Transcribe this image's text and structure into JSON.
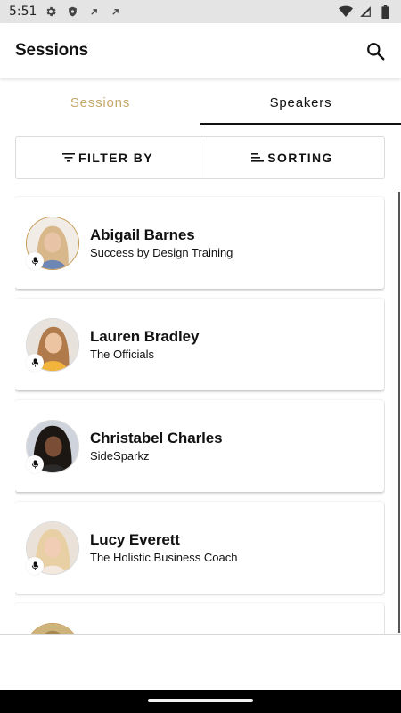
{
  "status_bar": {
    "time": "5:51",
    "left_icons": [
      "gear-icon",
      "shield-icon",
      "sync-icon",
      "sync-icon"
    ],
    "right_icons": [
      "wifi-icon",
      "signal-icon",
      "battery-icon"
    ]
  },
  "app_bar": {
    "title": "Sessions",
    "search_icon": "search-icon"
  },
  "tabs": [
    {
      "label": "Sessions",
      "active": false
    },
    {
      "label": "Speakers",
      "active": true
    }
  ],
  "colors": {
    "accent_gold": "#c4a86a",
    "avatar_ring": "#c49a55",
    "text": "#111111"
  },
  "controls": {
    "filter_label": "FILTER BY",
    "filter_icon": "filter-icon",
    "sort_label": "SORTING",
    "sort_icon": "sort-icon"
  },
  "speakers": [
    {
      "name": "Abigail Barnes",
      "org": "Success by Design Training",
      "badge_icon": "mic-icon"
    },
    {
      "name": "Lauren Bradley",
      "org": "The Officials",
      "badge_icon": "mic-icon"
    },
    {
      "name": "Christabel Charles",
      "org": "SideSparkz",
      "badge_icon": "mic-icon"
    },
    {
      "name": "Lucy Everett",
      "org": "The Holistic Business Coach",
      "badge_icon": "mic-icon"
    },
    {
      "name": "",
      "org": "",
      "badge_icon": "mic-icon"
    }
  ]
}
